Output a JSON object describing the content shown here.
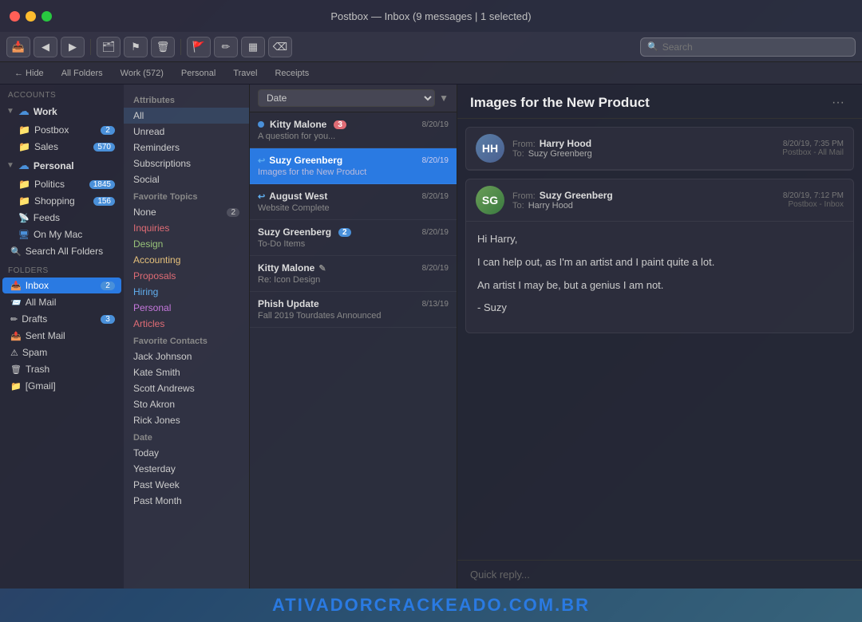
{
  "window": {
    "title": "Postbox — Inbox (9 messages | 1 selected)"
  },
  "toolbar": {
    "back_label": "◀",
    "forward_label": "▶",
    "archive_label": "🗂",
    "flag_label": "🚩",
    "delete_label": "🗑",
    "tag_label": "🏷",
    "compose_label": "✏",
    "filter_label": "▦",
    "eraser_label": "⌫",
    "search_placeholder": "Search"
  },
  "tabs": [
    {
      "label": "← Hide",
      "active": false
    },
    {
      "label": "All Folders",
      "active": false
    },
    {
      "label": "Work (572)",
      "active": false
    },
    {
      "label": "Personal",
      "active": false
    },
    {
      "label": "Travel",
      "active": false
    },
    {
      "label": "Receipts",
      "active": false
    }
  ],
  "sidebar": {
    "accounts_label": "Accounts",
    "folders_label": "Folders",
    "work_label": "Work",
    "postbox_label": "Postbox",
    "postbox_count": "2",
    "sales_label": "Sales",
    "sales_count": "570",
    "personal_label": "Personal",
    "politics_label": "Politics",
    "politics_count": "1845",
    "shopping_label": "Shopping",
    "shopping_count": "156",
    "feeds_label": "Feeds",
    "on_my_mac_label": "On My Mac",
    "search_all_label": "Search All Folders",
    "inbox_label": "Inbox",
    "inbox_count": "2",
    "all_mail_label": "All Mail",
    "drafts_label": "Drafts",
    "drafts_count": "3",
    "sent_mail_label": "Sent Mail",
    "spam_label": "Spam",
    "trash_label": "Trash",
    "gmail_label": "[Gmail]"
  },
  "filter_panel": {
    "attributes_label": "Attributes",
    "all_label": "All",
    "unread_label": "Unread",
    "reminders_label": "Reminders",
    "subscriptions_label": "Subscriptions",
    "social_label": "Social",
    "favorite_topics_label": "Favorite Topics",
    "none_label": "None",
    "none_count": "2",
    "inquiries_label": "Inquiries",
    "design_label": "Design",
    "accounting_label": "Accounting",
    "proposals_label": "Proposals",
    "hiring_label": "Hiring",
    "personal_label": "Personal",
    "articles_label": "Articles",
    "favorite_contacts_label": "Favorite Contacts",
    "contact1": "Jack Johnson",
    "contact2": "Kate Smith",
    "contact3": "Scott Andrews",
    "contact4": "Sto Akron",
    "contact5": "Rick Jones",
    "date_label": "Date",
    "today_label": "Today",
    "yesterday_label": "Yesterday",
    "past_week_label": "Past Week",
    "past_month_label": "Past Month"
  },
  "message_list": {
    "sort_label": "Date",
    "messages": [
      {
        "sender": "Kitty Malone",
        "date": "8/20/19",
        "preview": "A question for you...",
        "badge": "3",
        "badge_type": "red",
        "selected": false,
        "unread": true,
        "has_reply": false
      },
      {
        "sender": "Suzy Greenberg",
        "date": "8/20/19",
        "preview": "Images for the New Product",
        "badge": "",
        "badge_type": "",
        "selected": true,
        "unread": false,
        "has_reply": true
      },
      {
        "sender": "August West",
        "date": "8/20/19",
        "preview": "Website Complete",
        "badge": "",
        "badge_type": "",
        "selected": false,
        "unread": false,
        "has_reply": true
      },
      {
        "sender": "Suzy Greenberg",
        "date": "8/20/19",
        "preview": "To-Do Items",
        "badge": "2",
        "badge_type": "blue",
        "selected": false,
        "unread": false,
        "has_reply": false
      },
      {
        "sender": "Kitty Malone",
        "date": "8/20/19",
        "preview": "Re: Icon Design",
        "badge": "",
        "badge_type": "",
        "selected": false,
        "unread": false,
        "has_reply": false,
        "has_pencil": true
      },
      {
        "sender": "Phish Update",
        "date": "8/13/19",
        "preview": "Fall 2019 Tourdates Announced",
        "badge": "",
        "badge_type": "",
        "selected": false,
        "unread": false,
        "has_reply": false
      }
    ]
  },
  "detail": {
    "title": "Images for the New Product",
    "email1": {
      "from_label": "From:",
      "from_name": "Harry Hood",
      "to_label": "To:",
      "to_name": "Suzy Greenberg",
      "timestamp": "8/20/19, 7:35 PM",
      "location": "Postbox - All Mail",
      "avatar_initials": "HH"
    },
    "email2": {
      "from_label": "From:",
      "from_name": "Suzy Greenberg",
      "to_label": "To:",
      "to_name": "Harry Hood",
      "timestamp": "8/20/19, 7:12 PM",
      "location": "Postbox - Inbox",
      "avatar_initials": "SG",
      "body_line1": "Hi Harry,",
      "body_line2": "I can help out, as I'm an artist and I paint quite a lot.",
      "body_line3": "An artist I may be, but a genius I am not.",
      "body_line4": "- Suzy"
    },
    "quick_reply_placeholder": "Quick reply..."
  },
  "watermark": "ATIVADORCRACKEADO.COM.BR"
}
